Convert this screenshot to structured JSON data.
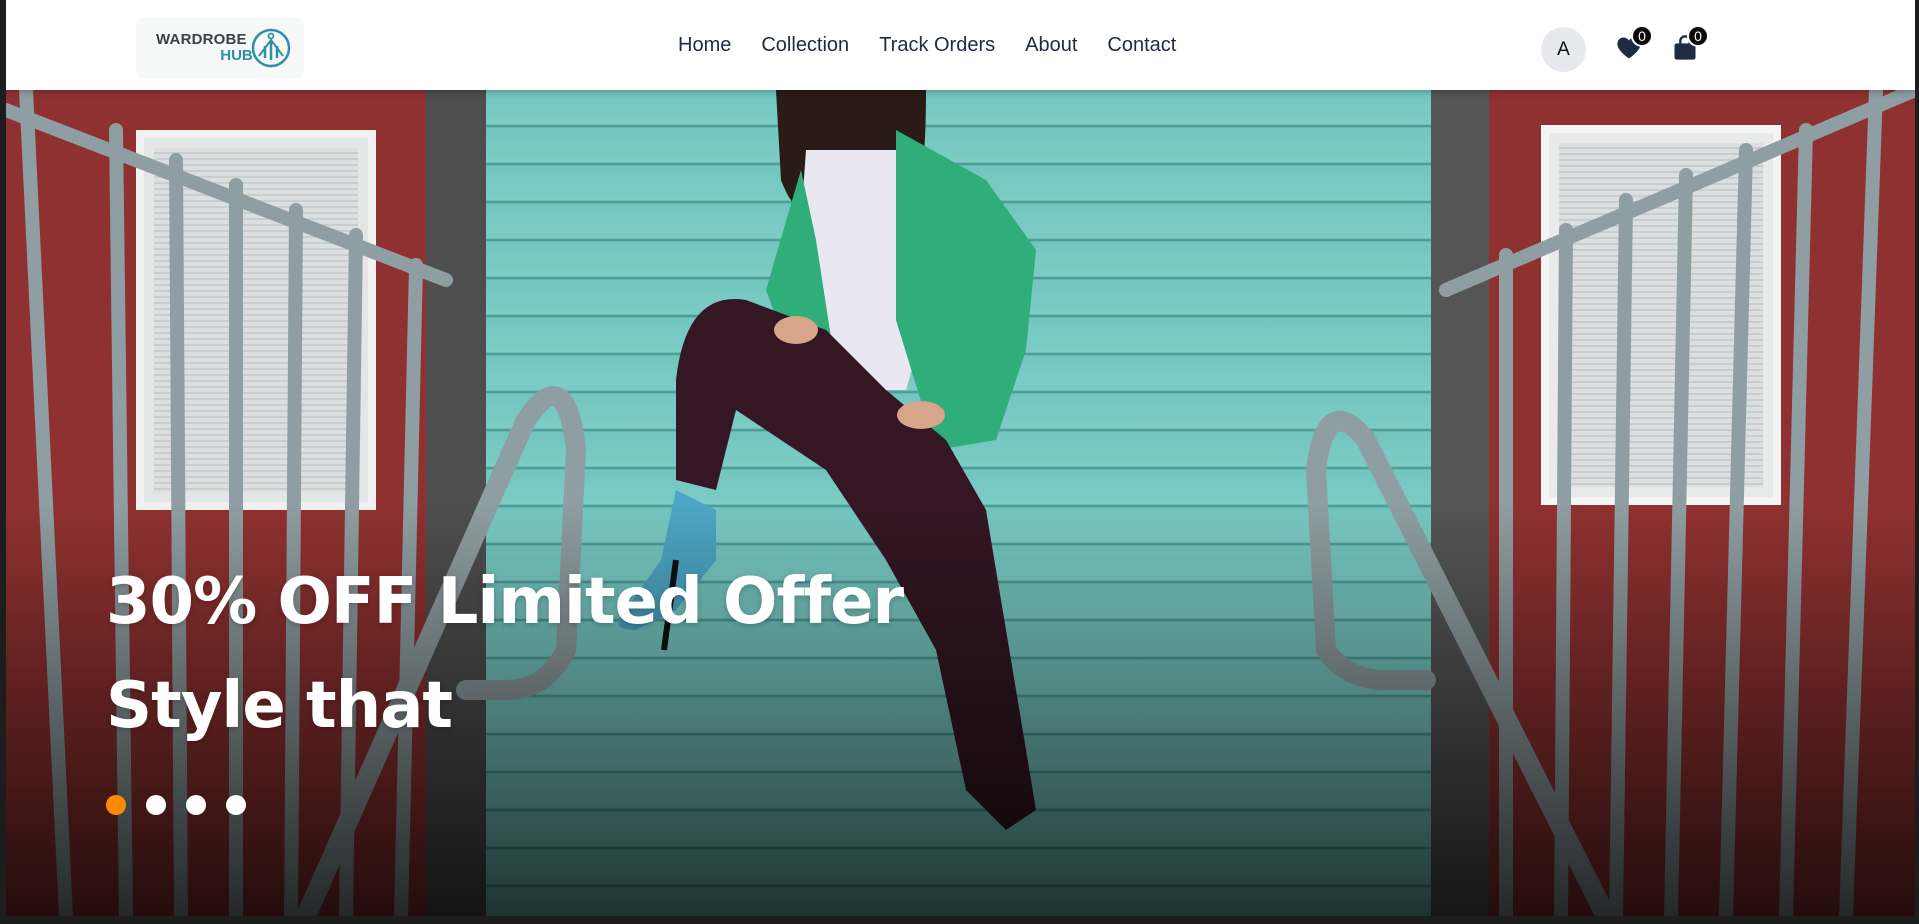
{
  "header": {
    "logo": {
      "line1": "WARDROBE",
      "line2": "HUB"
    },
    "nav": [
      {
        "label": "Home"
      },
      {
        "label": "Collection"
      },
      {
        "label": "Track Orders"
      },
      {
        "label": "About"
      },
      {
        "label": "Contact"
      }
    ],
    "avatar_initial": "A",
    "wishlist": {
      "icon": "heart-icon",
      "count": "0"
    },
    "cart": {
      "icon": "shopping-bag-icon",
      "count": "0"
    }
  },
  "hero": {
    "line1": "30% OFF Limited Offer",
    "line2": "Style that",
    "slides": {
      "total": 4,
      "active_index": 0
    },
    "colors": {
      "active_dot": "#ff8a00",
      "inactive_dot": "#ffffff"
    }
  }
}
